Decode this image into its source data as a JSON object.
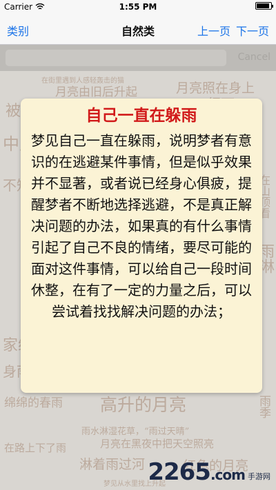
{
  "status_bar": {
    "carrier": "Carrier",
    "time": "1:55 PM",
    "battery_level": 0.9
  },
  "nav": {
    "left_label": "类别",
    "title": "自然类",
    "prev_label": "上一页",
    "next_label": "下一页"
  },
  "search": {
    "cancel_label": "Cancel"
  },
  "background_words": [
    "在街里遇到人感轻轰击的猫",
    "月亮由旧后升起",
    "月亮照在身上",
    "被雨淋",
    "中风",
    "不知天",
    "家给",
    "身雨",
    "细雨",
    "绵绵的春雨",
    "高升的月亮",
    "雨水淋湿花草，“雨过天晴”",
    "在路上下了雨",
    "月亮在黑夜中把天空照亮",
    "淋着雨过河",
    "红色的月亮",
    "梦见从水里找上升起",
    "在山顶看",
    "雨淋",
    "雨季"
  ],
  "card": {
    "title": "自己一直在躲雨",
    "body": "梦见自己一直在躲雨，说明梦者有意识的在逃避某件事情，但是似乎效果并不显著，或者说已经身心俱疲，提醒梦者不断地选择逃避，不是真正解决问题的办法，如果真的有什么事情引起了自己不良的情绪，要尽可能的面对这件事情，可以给自己一段时间休整，在有了一定的力量之后，可以尝试着找找解决问题的办法；"
  },
  "watermark": {
    "logo": "2265",
    "suffix": ".com",
    "sub": "手游网"
  }
}
